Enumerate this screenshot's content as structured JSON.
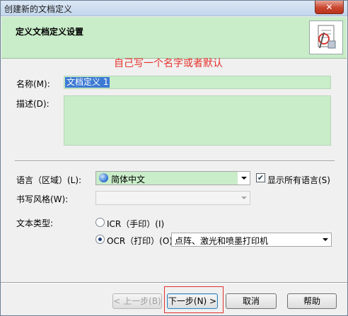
{
  "window": {
    "title": "创建新的文档定义",
    "close_glyph": "✕"
  },
  "header": {
    "title": "定义文档定义设置",
    "icon": "document-edit-icon"
  },
  "annotation": "自己写一个名字或者默认",
  "fields": {
    "name_label": "名称(M):",
    "name_value": "文档定义 1",
    "description_label": "描述(D):",
    "description_value": ""
  },
  "language": {
    "label": "语言（区域）(L):",
    "value": "简体中文",
    "show_all_label": "显示所有语言(S)",
    "show_all_checked": true,
    "check_glyph": "✔"
  },
  "writing_style": {
    "label": "书写风格(W):",
    "value": ""
  },
  "text_type": {
    "label": "文本类型:",
    "icr_label": "ICR（手印）(I)",
    "ocr_label": "OCR（打印）(O)",
    "selected": "ocr",
    "ocr_option": "点阵、激光和喷墨打印机"
  },
  "buttons": {
    "back": "< 上一步(B)",
    "next": "下一步(N) >",
    "cancel": "取消",
    "help": "帮助"
  },
  "colors": {
    "accent_green": "#c9ecc9",
    "annotation_red": "#e4322b"
  }
}
